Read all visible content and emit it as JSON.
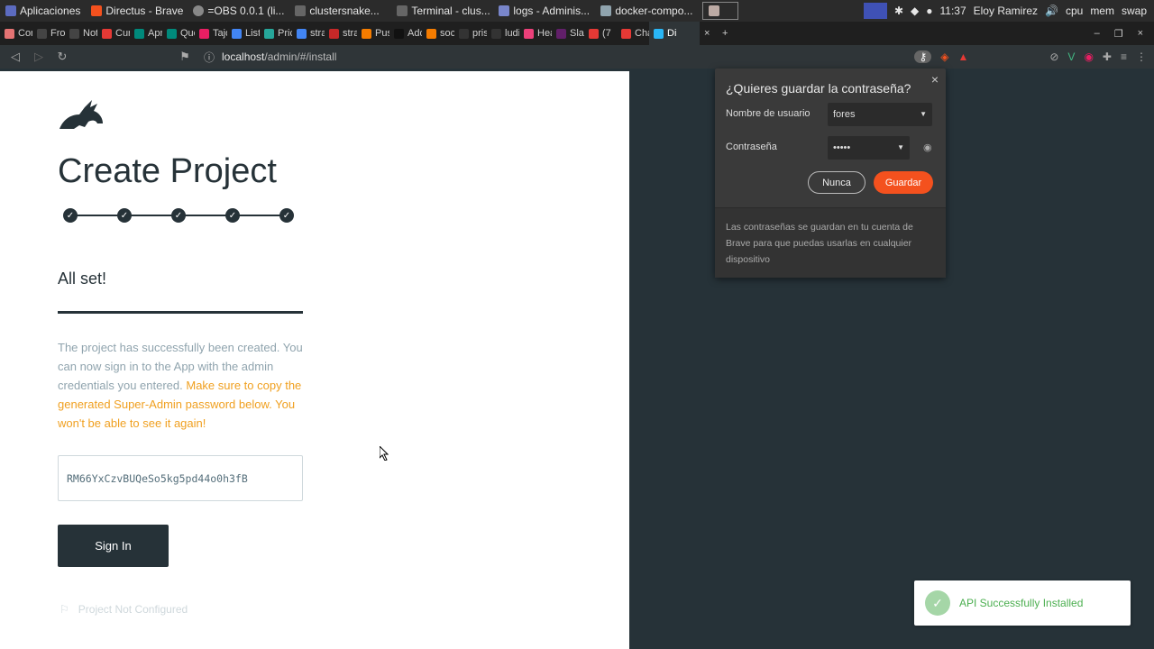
{
  "taskbar": {
    "tasks": [
      {
        "label": "Aplicaciones"
      },
      {
        "label": "Directus - Brave"
      },
      {
        "label": "=OBS 0.0.1 (li..."
      },
      {
        "label": "clustersnake..."
      },
      {
        "label": "Terminal - clus..."
      },
      {
        "label": "logs - Adminis..."
      },
      {
        "label": "docker-compo..."
      }
    ],
    "tray": {
      "time": "11:37",
      "user": "Eloy Ramirez",
      "cpu": "cpu",
      "mem": "mem",
      "swap": "swap"
    }
  },
  "tabs": [
    {
      "label": "Conta",
      "color": "#e57373"
    },
    {
      "label": "Fronte",
      "color": "#444"
    },
    {
      "label": "Notifi",
      "color": "#444"
    },
    {
      "label": "Curso",
      "color": "#e53935"
    },
    {
      "label": "Apren",
      "color": "#00897b"
    },
    {
      "label": "Qué s",
      "color": "#00897b"
    },
    {
      "label": "Tajo",
      "color": "#e91e63"
    },
    {
      "label": "Listad",
      "color": "#4285f4"
    },
    {
      "label": "Pricin",
      "color": "#26a69a"
    },
    {
      "label": "strapi",
      "color": "#4285f4"
    },
    {
      "label": "strapi",
      "color": "#c62828"
    },
    {
      "label": "Push",
      "color": "#f57c00"
    },
    {
      "label": "Addin",
      "color": "#111"
    },
    {
      "label": "socke",
      "color": "#f57c00"
    },
    {
      "label": "prism",
      "color": "#333"
    },
    {
      "label": "ludin",
      "color": "#333"
    },
    {
      "label": "Head",
      "color": "#ec407a"
    },
    {
      "label": "Slack",
      "color": "#611f69"
    },
    {
      "label": "(7",
      "color": "#e53935"
    },
    {
      "label": "Chan",
      "color": "#e53935"
    },
    {
      "label": "Di",
      "color": "#29b6f6"
    }
  ],
  "address": {
    "host": "localhost",
    "path": "/admin/#/install"
  },
  "page": {
    "title": "Create Project",
    "steps_completed": 5,
    "subtitle": "All set!",
    "desc_normal": "The project has successfully been created. You can now sign in to the App with the admin credentials you entered. ",
    "desc_warn": "Make sure to copy the generated Super-Admin password below. You won't be able to see it again!",
    "password": "RM66YxCzvBUQeSo5kg5pd44o0h3fB",
    "signin_label": "Sign In",
    "not_configured": "Project Not Configured"
  },
  "popup": {
    "title": "¿Quieres guardar la contraseña?",
    "username_label": "Nombre de usuario",
    "username_value": "fores",
    "password_label": "Contraseña",
    "password_value": "•••••",
    "btn_never": "Nunca",
    "btn_save": "Guardar",
    "footer": "Las contraseñas se guardan en tu cuenta de Brave para que puedas usarlas en cualquier dispositivo"
  },
  "toast": {
    "message": "API Successfully Installed"
  },
  "colors": {
    "accent": "#f4511e",
    "dark": "#263238",
    "warn": "#f0a020",
    "success": "#4caf50"
  }
}
